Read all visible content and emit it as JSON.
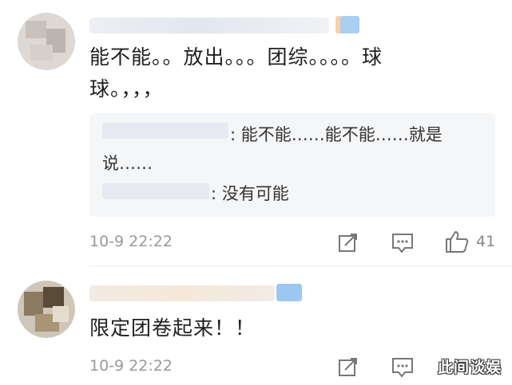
{
  "comments": [
    {
      "text_line1": "能不能。。放出。。。团综。。。。球",
      "text_line2": "球。，，，",
      "replies": [
        {
          "text_line1": ": 能不能……能不能……就是",
          "text_line2": "说……"
        },
        {
          "text": ": 没有可能"
        }
      ],
      "timestamp": "10-9 22:22",
      "like_count": "41"
    },
    {
      "text": "限定团卷起来！！",
      "timestamp": "10-9 22:22"
    }
  ],
  "watermark": "此间谈娱",
  "icons": {
    "share": "share-icon",
    "comment": "comment-icon",
    "like": "thumbs-up-icon"
  },
  "colors": {
    "text": "#1f1f1f",
    "meta": "#999999",
    "reply_bg": "#f5f6f8",
    "badge_blue": "#9cc8f2",
    "badge_orange": "#f6d2a8"
  }
}
